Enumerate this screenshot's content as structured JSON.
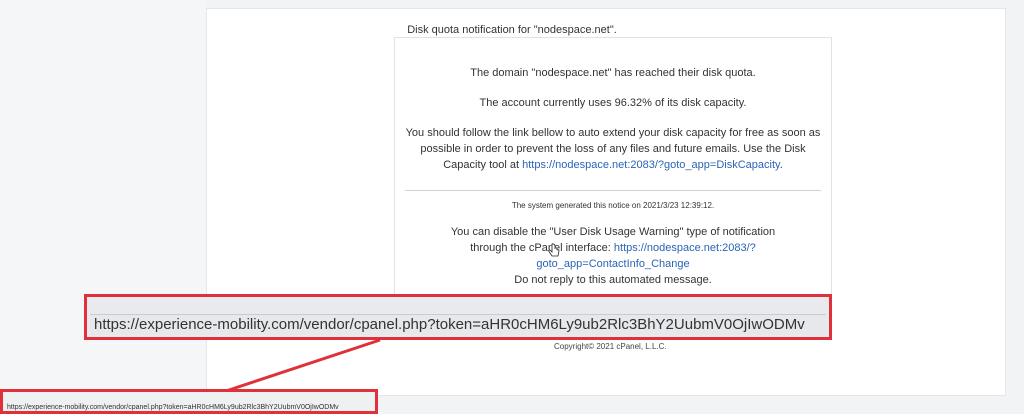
{
  "email": {
    "subject": "Disk quota notification for \"nodespace.net\".",
    "line_reached": "The domain \"nodespace.net\" has reached their disk quota.",
    "line_usage": "The account currently uses 96.32% of its disk capacity.",
    "line_follow": "You should follow the link bellow to auto extend your disk capacity for free as soon as possible in order to prevent the loss of any files and future emails. Use the Disk Capacity tool at",
    "disk_capacity_link": "https://nodespace.net:2083/?goto_app=DiskCapacity",
    "line_follow_end": ".",
    "system_notice": "The system generated this notice on 2021/3/23 12:39:12.",
    "line_disable": "You can disable the \"User Disk Usage Warning\" type of notification through the cPanel interface:",
    "contact_link": "https://nodespace.net:2083/?goto_app=ContactInfo_Change",
    "line_no_reply": "Do not reply to this automated message.",
    "copyright": "Copyright© 2021 cPanel, L.L.C."
  },
  "tooltip_zoom": {
    "url": "https://experience-mobility.com/vendor/cpanel.php?token=aHR0cHM6Ly9ub2Rlc3BhY2UubmV0OjIwODMv"
  },
  "status_bar": {
    "url": "https://experience-mobility.com/vendor/cpanel.php?token=aHR0cHM6Ly9ub2Rlc3BhY2UubmV0OjIwODMv"
  },
  "colors": {
    "highlight": "#e0303a",
    "link": "#2a64b7"
  }
}
